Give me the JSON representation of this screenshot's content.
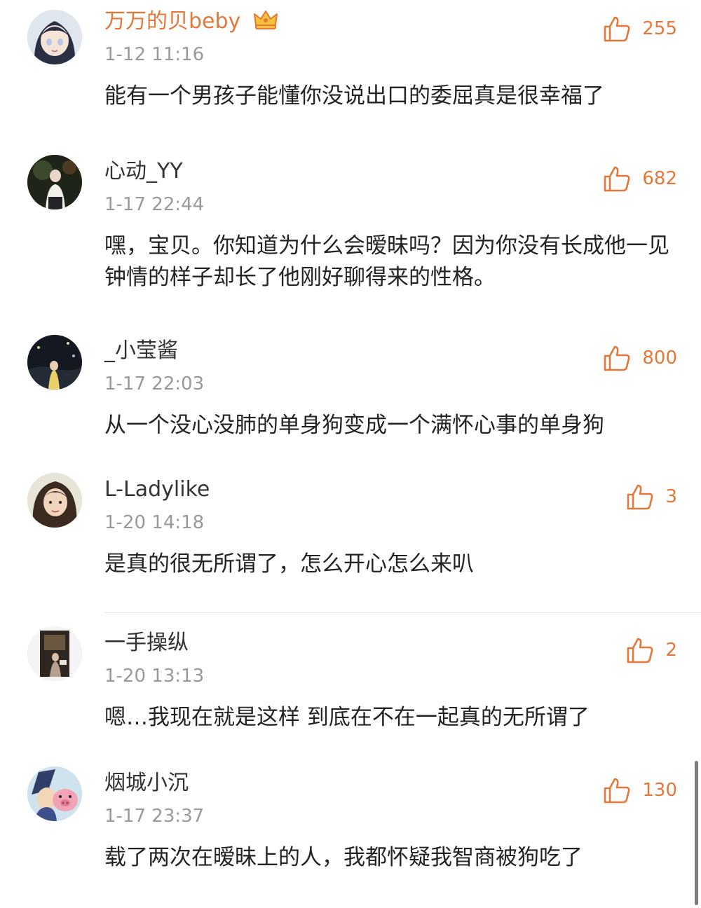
{
  "comments": [
    {
      "username": "万万的贝beby",
      "vip": true,
      "time": "1-12 11:16",
      "likes": "255",
      "text": "能有一个男孩子能懂你没说出口的委屈真是很幸福了"
    },
    {
      "username": "心动_YY",
      "vip": false,
      "time": "1-17 22:44",
      "likes": "682",
      "text": "嘿，宝贝。你知道为什么会暧昧吗？因为你没有长成他一见钟情的样子却长了他刚好聊得来的性格。"
    },
    {
      "username": "_小莹酱",
      "vip": false,
      "time": "1-17 22:03",
      "likes": "800",
      "text": "从一个没心没肺的单身狗变成一个满怀心事的单身狗"
    },
    {
      "username": "L-Ladylike",
      "vip": false,
      "time": "1-20 14:18",
      "likes": "3",
      "text": "是真的很无所谓了，怎么开心怎么来叭"
    },
    {
      "username": "一手操纵",
      "vip": false,
      "time": "1-20 13:13",
      "likes": "2",
      "text": "嗯…我现在就是这样 到底在不在一起真的无所谓了"
    },
    {
      "username": "烟城小沉",
      "vip": false,
      "time": "1-17 23:37",
      "likes": "130",
      "text": "载了两次在暧昧上的人，我都怀疑我智商被狗吃了"
    }
  ],
  "colors": {
    "accent": "#e3783a",
    "vip_name": "#e3783a",
    "timestamp": "#9a9a9a",
    "text": "#232323"
  },
  "icons": {
    "like": "thumbs-up-icon",
    "vip": "crown-icon"
  }
}
